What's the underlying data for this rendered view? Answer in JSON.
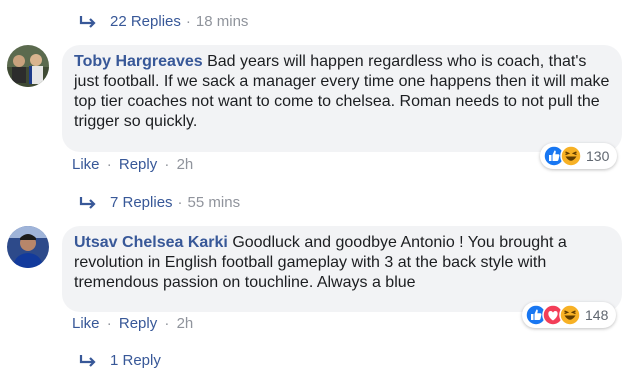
{
  "threads": [
    {
      "replies_label": "22 Replies",
      "replies_time": "18 mins"
    },
    {
      "author": "Toby Hargreaves",
      "text": "Bad years will happen regardless who is coach, that's just football. If we sack a manager every time one happens then it will make top tier coaches not want to come to chelsea. Roman needs to not pull the trigger so quickly.",
      "like_label": "Like",
      "reply_label": "Reply",
      "time": "2h",
      "reaction_count": "130",
      "reaction_icons": [
        "like-icon",
        "haha-icon"
      ],
      "replies_label": "7 Replies",
      "replies_time": "55 mins"
    },
    {
      "author": "Utsav Chelsea Karki",
      "text": "Goodluck and goodbye Antonio ! You brought a revolution in English football gameplay with 3 at the back style with tremendous passion on touchline. Always a blue",
      "like_label": "Like",
      "reply_label": "Reply",
      "time": "2h",
      "reaction_count": "148",
      "reaction_icons": [
        "like-icon",
        "love-icon",
        "haha-icon"
      ],
      "replies_label": "1 Reply"
    }
  ],
  "separator": "·",
  "colors": {
    "link": "#385898",
    "muted": "#90949c",
    "bubble": "#f2f3f5",
    "like": "#1877f2",
    "love": "#f33e58",
    "haha": "#f7b125"
  }
}
